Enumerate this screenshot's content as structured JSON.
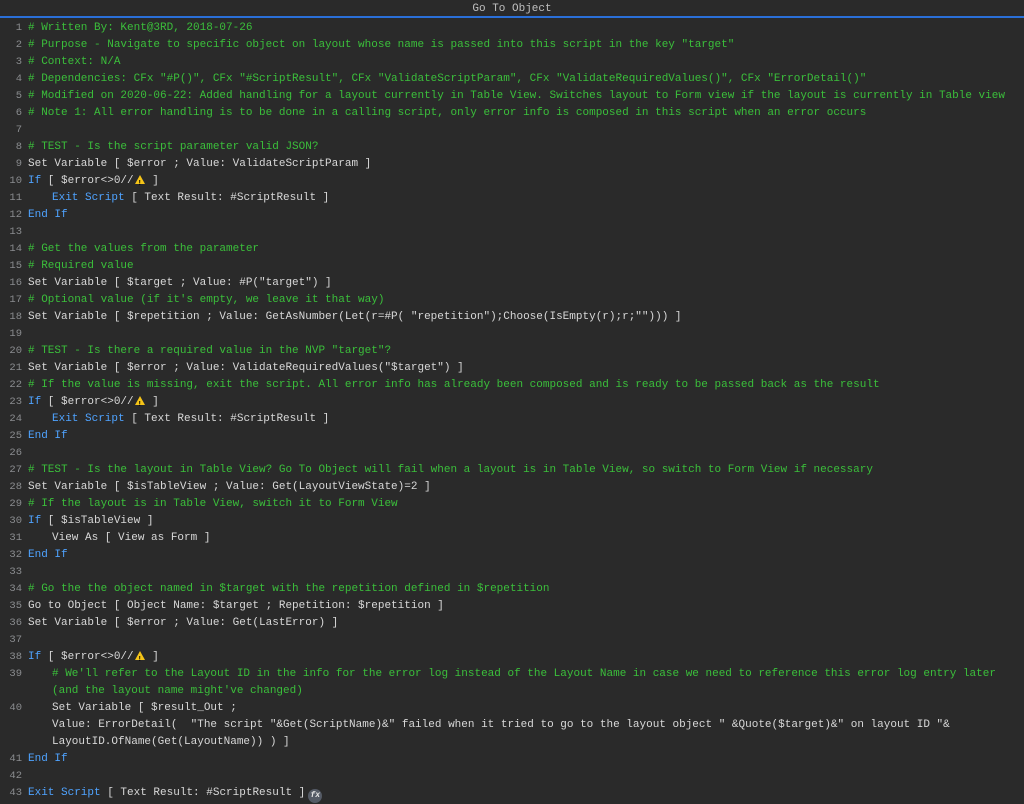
{
  "title": "Go To Object",
  "fx_label": "fx",
  "lines": [
    {
      "n": 1,
      "kind": "comment",
      "indent": 0,
      "text": "# Written By: Kent@3RD, 2018-07-26"
    },
    {
      "n": 2,
      "kind": "comment",
      "indent": 0,
      "text": "# Purpose - Navigate to specific object on layout whose name is passed into this script in the key \"target\""
    },
    {
      "n": 3,
      "kind": "comment",
      "indent": 0,
      "text": "# Context: N/A"
    },
    {
      "n": 4,
      "kind": "comment",
      "indent": 0,
      "text": "# Dependencies: CFx \"#P()\", CFx \"#ScriptResult\", CFx \"ValidateScriptParam\", CFx \"ValidateRequiredValues()\", CFx \"ErrorDetail()\""
    },
    {
      "n": 5,
      "kind": "comment",
      "indent": 0,
      "text": "# Modified on 2020-06-22: Added handling for a layout currently in Table View. Switches layout to Form view if the layout is currently in Table view"
    },
    {
      "n": 6,
      "kind": "comment",
      "indent": 0,
      "text": "# Note 1: All error handling is to be done in a calling script, only error info is composed in this script when an error occurs"
    },
    {
      "n": 7,
      "kind": "blank",
      "indent": 0,
      "text": ""
    },
    {
      "n": 8,
      "kind": "comment",
      "indent": 0,
      "text": "# TEST - Is the script parameter valid JSON?"
    },
    {
      "n": 9,
      "kind": "normal",
      "indent": 0,
      "text": "Set Variable [ $error ; Value: ValidateScriptParam ]"
    },
    {
      "n": 10,
      "kind": "if-warn",
      "indent": 0,
      "kw": "If",
      "rest": " [ $error<>0//",
      "tail": " ]"
    },
    {
      "n": 11,
      "kind": "kw-line",
      "indent": 1,
      "kw": "Exit Script",
      "rest": " [ Text Result: #ScriptResult ]"
    },
    {
      "n": 12,
      "kind": "kw-only",
      "indent": 0,
      "kw": "End If"
    },
    {
      "n": 13,
      "kind": "blank",
      "indent": 0,
      "text": ""
    },
    {
      "n": 14,
      "kind": "comment",
      "indent": 0,
      "text": "# Get the values from the parameter"
    },
    {
      "n": 15,
      "kind": "comment",
      "indent": 0,
      "text": "# Required value"
    },
    {
      "n": 16,
      "kind": "normal",
      "indent": 0,
      "text": "Set Variable [ $target ; Value: #P(\"target\") ]"
    },
    {
      "n": 17,
      "kind": "comment",
      "indent": 0,
      "text": "# Optional value (if it's empty, we leave it that way)"
    },
    {
      "n": 18,
      "kind": "normal",
      "indent": 0,
      "text": "Set Variable [ $repetition ; Value: GetAsNumber(Let(r=#P( \"repetition\");Choose(IsEmpty(r);r;\"\"))) ]"
    },
    {
      "n": 19,
      "kind": "blank",
      "indent": 0,
      "text": ""
    },
    {
      "n": 20,
      "kind": "comment",
      "indent": 0,
      "text": "# TEST - Is there a required value in the NVP \"target\"?"
    },
    {
      "n": 21,
      "kind": "normal",
      "indent": 0,
      "text": "Set Variable [ $error ; Value: ValidateRequiredValues(\"$target\") ]"
    },
    {
      "n": 22,
      "kind": "comment",
      "indent": 0,
      "text": "# If the value is missing, exit the script. All error info has already been composed and is ready to be passed back as the result"
    },
    {
      "n": 23,
      "kind": "if-warn",
      "indent": 0,
      "kw": "If",
      "rest": " [ $error<>0//",
      "tail": " ]"
    },
    {
      "n": 24,
      "kind": "kw-line",
      "indent": 1,
      "kw": "Exit Script",
      "rest": " [ Text Result: #ScriptResult ]"
    },
    {
      "n": 25,
      "kind": "kw-only",
      "indent": 0,
      "kw": "End If"
    },
    {
      "n": 26,
      "kind": "blank",
      "indent": 0,
      "text": ""
    },
    {
      "n": 27,
      "kind": "comment",
      "indent": 0,
      "text": "# TEST - Is the layout in Table View? Go To Object will fail when a layout is in Table View, so switch to Form View if necessary"
    },
    {
      "n": 28,
      "kind": "normal",
      "indent": 0,
      "text": "Set Variable [ $isTableView ; Value: Get(LayoutViewState)=2 ]"
    },
    {
      "n": 29,
      "kind": "comment",
      "indent": 0,
      "text": "# If the layout is in Table View, switch it to Form View"
    },
    {
      "n": 30,
      "kind": "kw-line",
      "indent": 0,
      "kw": "If",
      "rest": " [ $isTableView ]"
    },
    {
      "n": 31,
      "kind": "normal",
      "indent": 1,
      "text": "View As [ View as Form ]"
    },
    {
      "n": 32,
      "kind": "kw-only",
      "indent": 0,
      "kw": "End If"
    },
    {
      "n": 33,
      "kind": "blank",
      "indent": 0,
      "text": ""
    },
    {
      "n": 34,
      "kind": "comment",
      "indent": 0,
      "text": "# Go the the object named in $target with the repetition defined in $repetition"
    },
    {
      "n": 35,
      "kind": "normal",
      "indent": 0,
      "text": "Go to Object [ Object Name: $target ; Repetition: $repetition ]"
    },
    {
      "n": 36,
      "kind": "normal",
      "indent": 0,
      "text": "Set Variable [ $error ; Value: Get(LastError) ]"
    },
    {
      "n": 37,
      "kind": "blank",
      "indent": 0,
      "text": ""
    },
    {
      "n": 38,
      "kind": "if-warn",
      "indent": 0,
      "kw": "If",
      "rest": " [ $error<>0//",
      "tail": " ]"
    },
    {
      "n": 39,
      "kind": "comment",
      "indent": 1,
      "text": "# We'll refer to the Layout ID in the info for the error log instead of the Layout Name in case we need to reference this error log entry later (and the layout name might've changed)"
    },
    {
      "n": 40,
      "kind": "two-line",
      "indent": 1,
      "first": "Set Variable [ $result_Out ;",
      "second": "Value: ErrorDetail(  \"The script \"&Get(ScriptName)&\" failed when it tried to go to the layout object \" &Quote($target)&\" on layout ID \"& LayoutID.OfName(Get(LayoutName)) ) ]"
    },
    {
      "n": 41,
      "kind": "kw-only",
      "indent": 0,
      "kw": "End If"
    },
    {
      "n": 42,
      "kind": "blank",
      "indent": 0,
      "text": ""
    },
    {
      "n": 43,
      "kind": "kw-line-fx",
      "indent": 0,
      "kw": "Exit Script",
      "rest": " [ Text Result: #ScriptResult ]"
    }
  ]
}
